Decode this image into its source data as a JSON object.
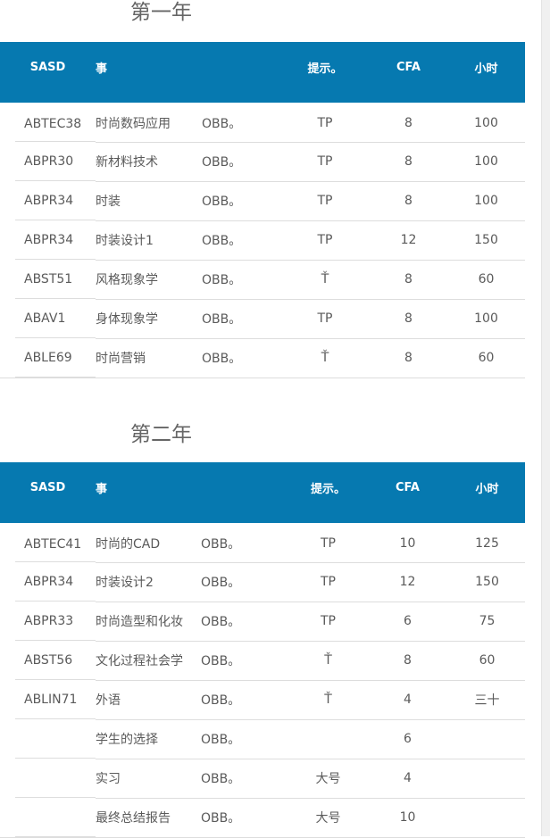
{
  "year1": {
    "title": "第一年",
    "headers": [
      "SASD",
      "事",
      "",
      "提示。",
      "CFA",
      "小时"
    ],
    "rows": [
      [
        "ABTEC38",
        "时尚数码应用",
        "OBB。",
        "TP",
        "8",
        "100"
      ],
      [
        "ABPR30",
        "新材料技术",
        "OBB。",
        "TP",
        "8",
        "100"
      ],
      [
        "ABPR34",
        "时装",
        "OBB。",
        "TP",
        "8",
        "100"
      ],
      [
        "ABPR34",
        "时装设计1",
        "OBB。",
        "TP",
        "12",
        "150"
      ],
      [
        "ABST51",
        "风格现象学",
        "OBB。",
        "Ť",
        "8",
        "60"
      ],
      [
        "ABAV1",
        "身体现象学",
        "OBB。",
        "TP",
        "8",
        "100"
      ],
      [
        "ABLE69",
        "时尚营销",
        "OBB。",
        "Ť",
        "8",
        "60"
      ]
    ]
  },
  "year2": {
    "title": "第二年",
    "headers": [
      "SASD",
      "事",
      "",
      "提示。",
      "CFA",
      "小时"
    ],
    "rows": [
      [
        "ABTEC41",
        "时尚的CAD",
        "OBB。",
        "TP",
        "10",
        "125"
      ],
      [
        "ABPR34",
        "时装设计2",
        "OBB。",
        "TP",
        "12",
        "150"
      ],
      [
        "ABPR33",
        "时尚造型和化妆",
        "OBB。",
        "TP",
        "6",
        "75"
      ],
      [
        "ABST56",
        "文化过程社会学",
        "OBB。",
        "Ť",
        "8",
        "60"
      ],
      [
        "ABLIN71",
        "外语",
        "OBB。",
        "Ť",
        "4",
        "三十"
      ],
      [
        "",
        "学生的选择",
        "OBB。",
        "",
        "6",
        ""
      ],
      [
        "",
        "实习",
        "OBB。",
        "大号",
        "4",
        ""
      ],
      [
        "",
        "最终总结报告",
        "OBB。",
        "大号",
        "10",
        ""
      ]
    ]
  }
}
